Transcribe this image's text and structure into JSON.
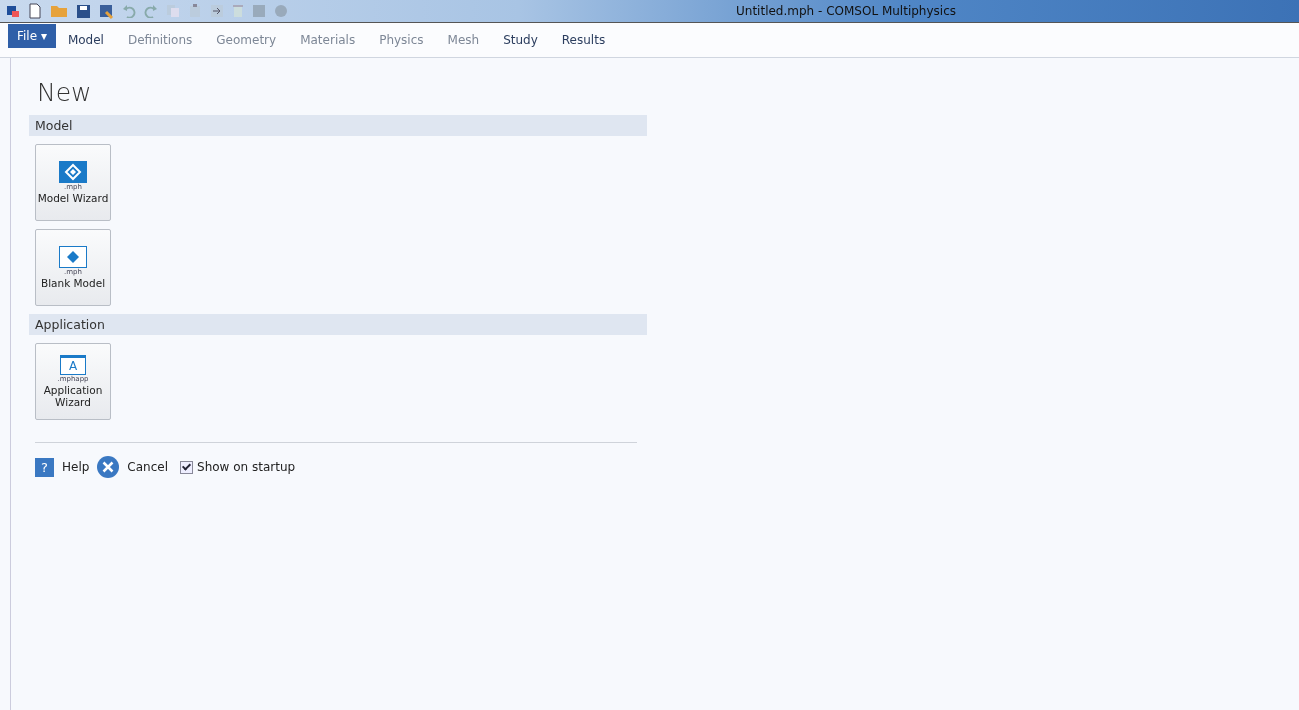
{
  "window": {
    "title": "Untitled.mph - COMSOL Multiphysics"
  },
  "menu_tabs": [
    {
      "label": "File ▾",
      "kind": "file",
      "disabled": false,
      "selected": true
    },
    {
      "label": "Model",
      "kind": "tab",
      "disabled": false,
      "selected": false
    },
    {
      "label": "Definitions",
      "kind": "tab",
      "disabled": true,
      "selected": false
    },
    {
      "label": "Geometry",
      "kind": "tab",
      "disabled": true,
      "selected": false
    },
    {
      "label": "Materials",
      "kind": "tab",
      "disabled": true,
      "selected": false
    },
    {
      "label": "Physics",
      "kind": "tab",
      "disabled": true,
      "selected": false
    },
    {
      "label": "Mesh",
      "kind": "tab",
      "disabled": true,
      "selected": false
    },
    {
      "label": "Study",
      "kind": "tab",
      "disabled": false,
      "selected": false
    },
    {
      "label": "Results",
      "kind": "tab",
      "disabled": false,
      "selected": false
    }
  ],
  "page_title": "New",
  "sections": [
    {
      "title": "Model",
      "tiles": [
        {
          "kind": "model-wizard",
          "extension": ".mph",
          "label": "Model Wizard"
        },
        {
          "kind": "blank-model",
          "extension": ".mph",
          "label": "Blank Model"
        }
      ]
    },
    {
      "title": "Application",
      "tiles": [
        {
          "kind": "app-wizard",
          "icon_letter": "A",
          "extension": ".mphapp",
          "label": "Application Wizard"
        }
      ]
    }
  ],
  "footer": {
    "help": "Help",
    "cancel": "Cancel",
    "help_icon": "?",
    "show_on_startup": {
      "label": "Show on startup",
      "checked": true
    }
  }
}
